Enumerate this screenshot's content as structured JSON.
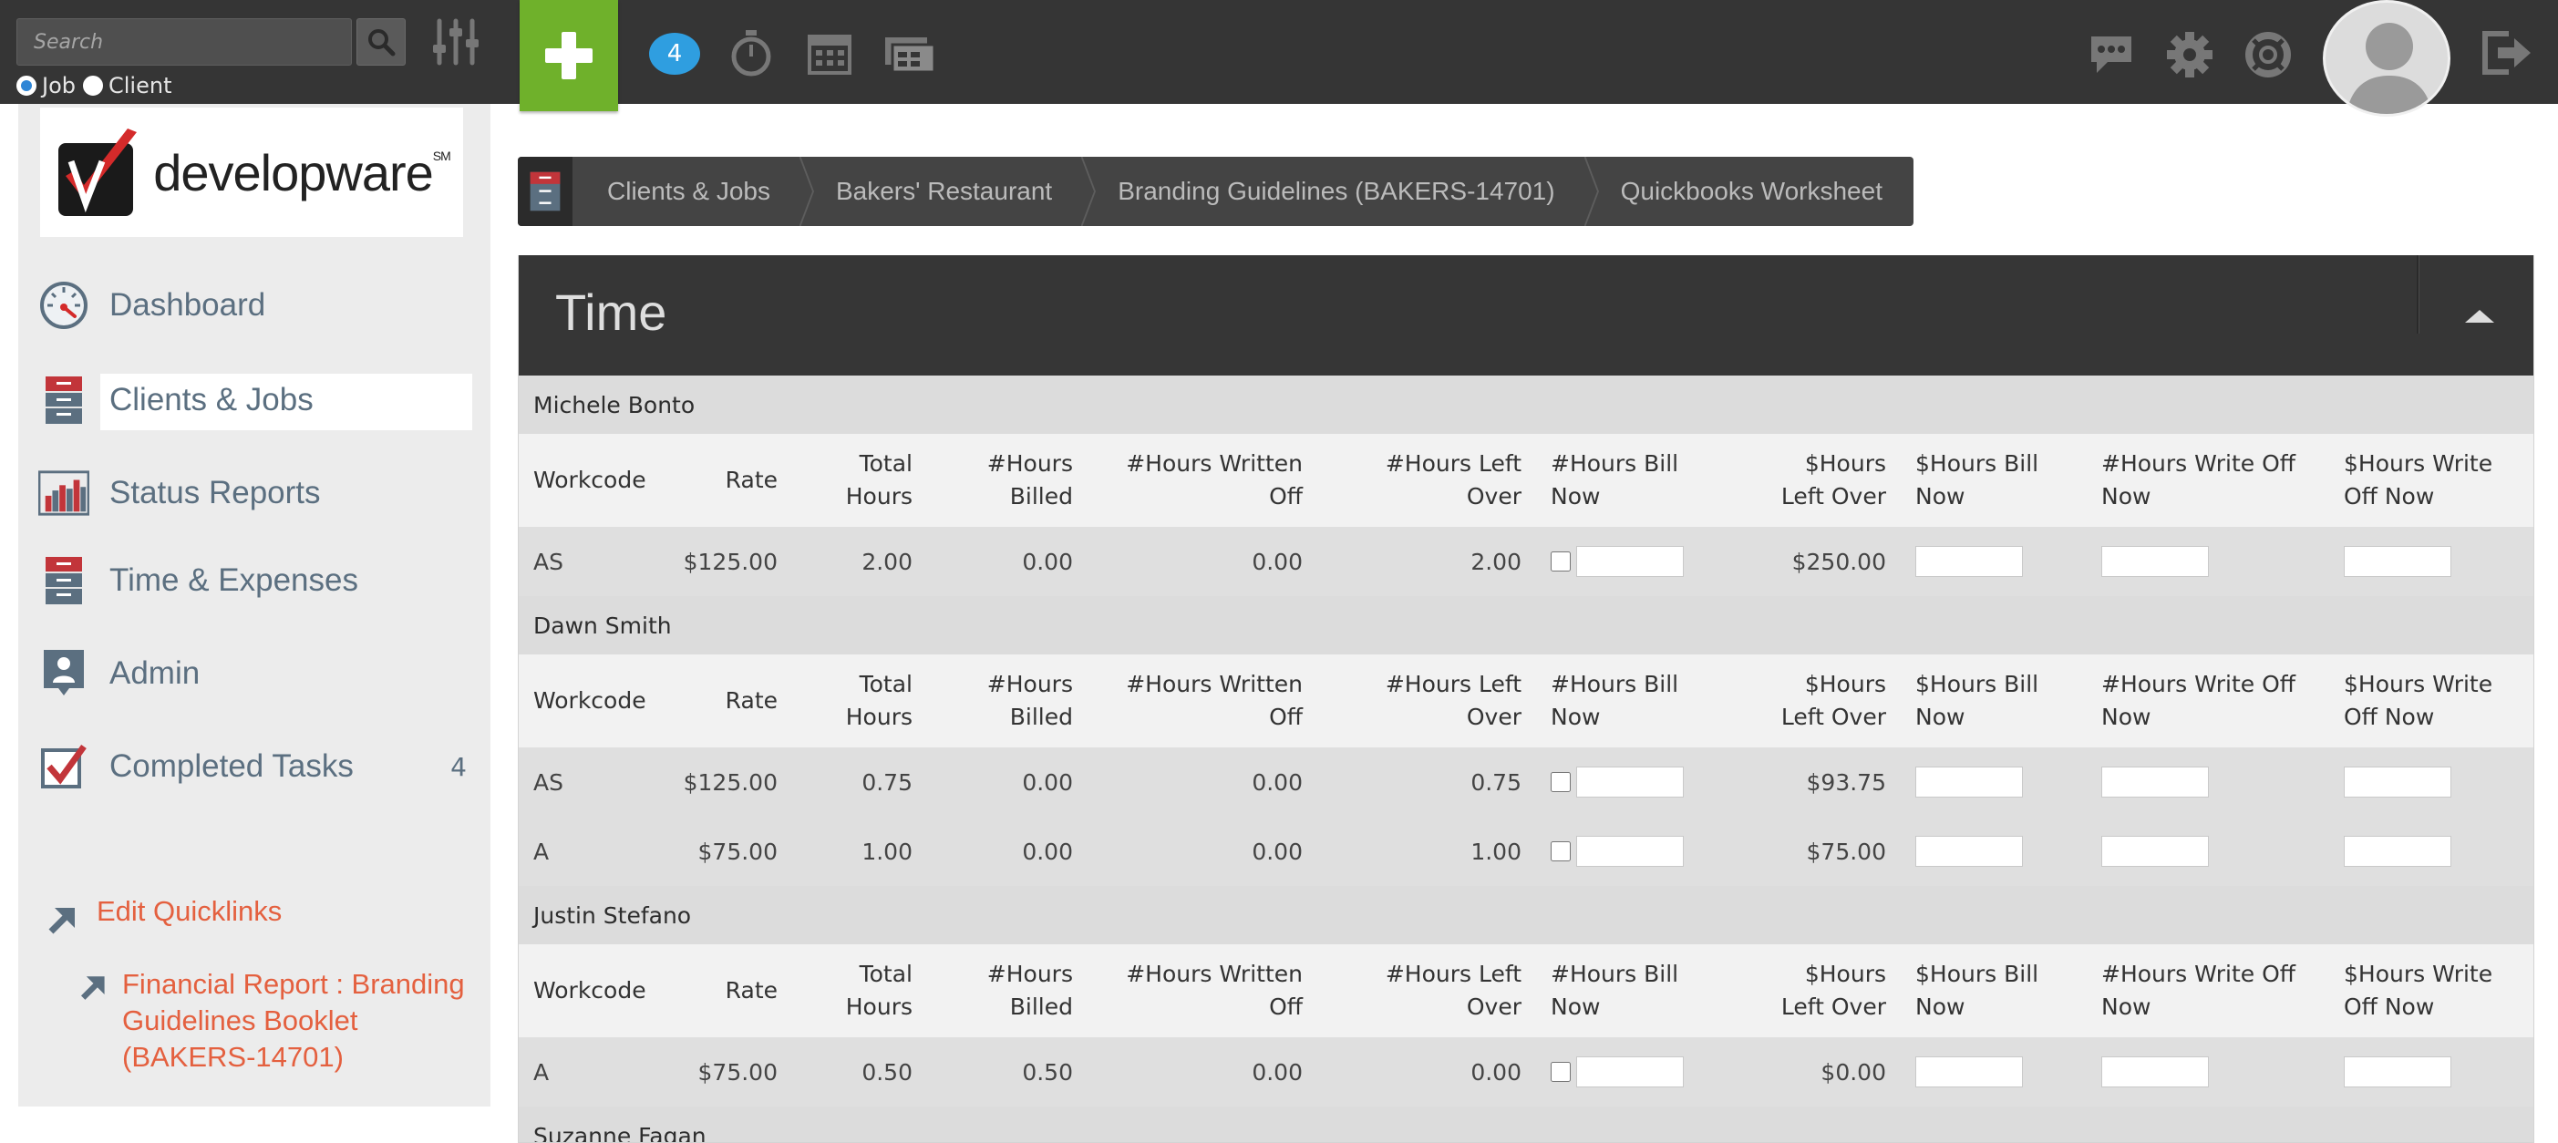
{
  "topbar": {
    "search_placeholder": "Search",
    "radio_job": "Job",
    "radio_client": "Client",
    "notification_count": "4"
  },
  "sidebar": {
    "logo_text": "developware",
    "logo_mark": "SM",
    "items": [
      {
        "label": "Dashboard",
        "icon": "dashboard-gauge-icon"
      },
      {
        "label": "Clients & Jobs",
        "icon": "file-cabinet-icon"
      },
      {
        "label": "Status Reports",
        "icon": "bar-chart-icon"
      },
      {
        "label": "Time & Expenses",
        "icon": "file-cabinet-icon"
      },
      {
        "label": "Admin",
        "icon": "admin-user-icon"
      },
      {
        "label": "Completed Tasks",
        "icon": "checkbox-icon",
        "count": "4"
      }
    ],
    "quicklinks": {
      "edit_label": "Edit Quicklinks",
      "link1": "Financial Report : Branding Guidelines Booklet (BAKERS-14701)"
    }
  },
  "breadcrumb": [
    "Clients & Jobs",
    "Bakers' Restaurant",
    "Branding Guidelines (BAKERS-14701)",
    "Quickbooks Worksheet"
  ],
  "panel": {
    "title": "Time",
    "headers": {
      "workcode": "Workcode",
      "rate": "Rate",
      "total_hours": "Total Hours",
      "hours_billed": "#Hours Billed",
      "hours_written_off": "#Hours Written Off",
      "hours_left_over": "#Hours Left Over",
      "hours_bill_now": "#Hours Bill Now",
      "dollar_left_over": "$Hours Left Over",
      "dollar_bill_now": "$Hours Bill Now",
      "hours_write_off_now": "#Hours Write Off Now",
      "dollar_write_off_now": "$Hours Write Off Now"
    },
    "groups": [
      {
        "name": "Michele Bonto",
        "rows": [
          {
            "workcode": "AS",
            "rate": "$125.00",
            "total": "2.00",
            "billed": "0.00",
            "written_off": "0.00",
            "left_over": "2.00",
            "dollar_left_over": "$250.00"
          }
        ]
      },
      {
        "name": "Dawn Smith",
        "rows": [
          {
            "workcode": "AS",
            "rate": "$125.00",
            "total": "0.75",
            "billed": "0.00",
            "written_off": "0.00",
            "left_over": "0.75",
            "dollar_left_over": "$93.75"
          },
          {
            "workcode": "A",
            "rate": "$75.00",
            "total": "1.00",
            "billed": "0.00",
            "written_off": "0.00",
            "left_over": "1.00",
            "dollar_left_over": "$75.00"
          }
        ]
      },
      {
        "name": "Justin Stefano",
        "rows": [
          {
            "workcode": "A",
            "rate": "$75.00",
            "total": "0.50",
            "billed": "0.50",
            "written_off": "0.00",
            "left_over": "0.00",
            "dollar_left_over": "$0.00"
          }
        ]
      },
      {
        "name": "Suzanne Fagan",
        "rows": []
      }
    ]
  },
  "colors": {
    "topbar": "#353535",
    "add_button": "#6fb12b",
    "badge": "#2f9ee0",
    "quicklink": "#e4603f",
    "nav_text": "#5b6f80"
  }
}
